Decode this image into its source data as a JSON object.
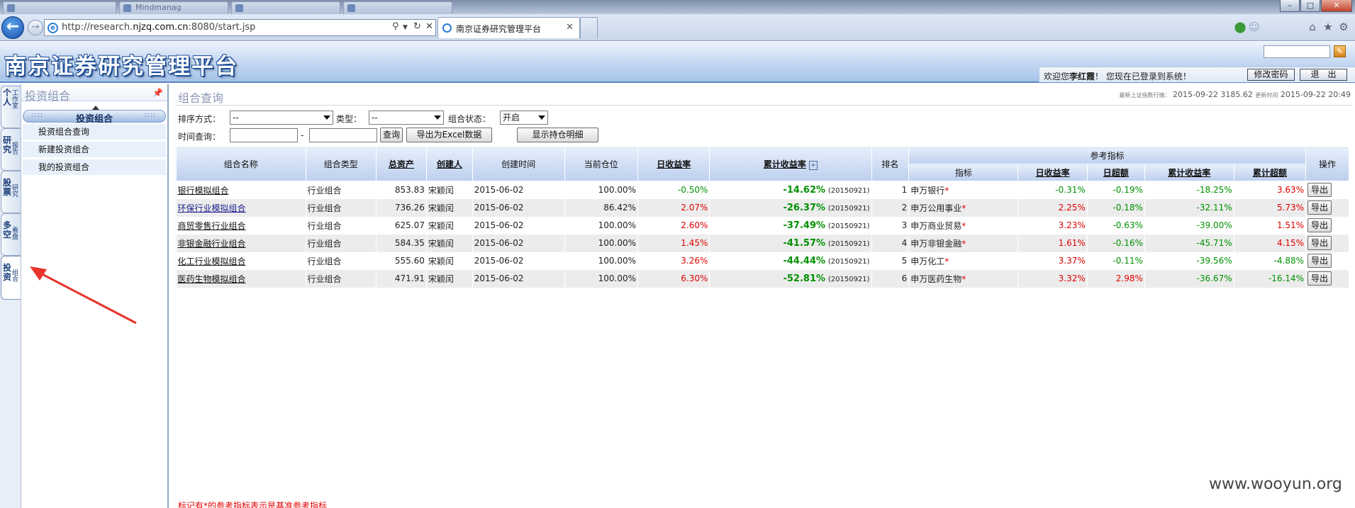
{
  "browser": {
    "background_tabs": [
      "",
      "Mindmanag",
      "",
      ""
    ],
    "address": "http://research.njzq.com.cn:8080/start.jsp",
    "address_prefix": "http://research.",
    "address_domain": "njzq.com.cn",
    "address_suffix": ":8080/start.jsp",
    "active_tab_title": "南京证券研究管理平台",
    "back_icon": "back-arrow-icon",
    "forward_icon": "forward-arrow-icon"
  },
  "header": {
    "app_title": "南京证券研究管理平台",
    "welcome_prefix": "欢迎您",
    "user_name": "李红霞",
    "welcome_suffix": "！ 您现在已登录到系统！",
    "change_password": "修改密码",
    "logout": "退　出"
  },
  "vtabs": [
    {
      "big": "个人",
      "small": "工作室"
    },
    {
      "big": "研究",
      "small": "报告"
    },
    {
      "big": "股票",
      "small": "研究"
    },
    {
      "big": "多空",
      "small": "看盘"
    },
    {
      "big": "投资",
      "small": "组合"
    }
  ],
  "left_panel": {
    "title": "投资组合",
    "section": "投资组合",
    "items": [
      "投资组合查询",
      "新建投资组合",
      "我的投资组合"
    ]
  },
  "main": {
    "title": "组合查询",
    "update_label": "最新上证指数行情：",
    "update_value": "2015-09-22 3185.62",
    "update_time_label": "更新时间",
    "update_time": "2015-09-22 20:49",
    "filters": {
      "sort_label": "排序方式：",
      "sort_value": "--",
      "type_label": "类型：",
      "type_value": "--",
      "status_label": "组合状态：",
      "status_value": "开启",
      "time_label": "时间查询：",
      "time_sep": "-",
      "query_btn": "查询",
      "export_excel_btn": "导出为Excel数据",
      "show_holdings_btn": "显示持仓明细"
    },
    "table": {
      "headers": {
        "name": "组合名称",
        "type": "组合类型",
        "assets": "总资产",
        "creator": "创建人",
        "created": "创建时间",
        "position": "当前仓位",
        "daily": "日收益率",
        "cumulative": "累计收益率",
        "rank": "排名",
        "ref_group": "参考指标",
        "ref_index": "指标",
        "ref_daily": "日收益率",
        "ref_daily_excess": "日超额",
        "ref_cum": "累计收益率",
        "ref_cum_excess": "累计超额",
        "action": "操作"
      },
      "rows": [
        {
          "name": "银行模拟组合",
          "type": "行业组合",
          "assets": "853.83",
          "creator": "宋颖闰",
          "created": "2015-06-02",
          "position": "100.00%",
          "daily": "-0.50%",
          "daily_color": "green",
          "cum": "-14.62%",
          "cum_date": "(20150921)",
          "rank": "1",
          "index": "申万银行",
          "ref_daily": "-0.31%",
          "ref_daily_color": "green",
          "ref_excess": "-0.19%",
          "ref_excess_color": "green",
          "ref_cum": "-18.25%",
          "ref_cum_excess": "3.63%",
          "ref_cum_excess_color": "red",
          "action": "导出"
        },
        {
          "name": "环保行业模拟组合",
          "type": "行业组合",
          "assets": "736.26",
          "creator": "宋颖闰",
          "created": "2015-06-02",
          "position": "86.42%",
          "daily": "2.07%",
          "daily_color": "red",
          "cum": "-26.37%",
          "cum_date": "(20150921)",
          "rank": "2",
          "index": "申万公用事业",
          "ref_daily": "2.25%",
          "ref_daily_color": "red",
          "ref_excess": "-0.18%",
          "ref_excess_color": "green",
          "ref_cum": "-32.11%",
          "ref_cum_excess": "5.73%",
          "ref_cum_excess_color": "red",
          "action": "导出"
        },
        {
          "name": "商贸零售行业组合",
          "type": "行业组合",
          "assets": "625.07",
          "creator": "宋颖闰",
          "created": "2015-06-02",
          "position": "100.00%",
          "daily": "2.60%",
          "daily_color": "red",
          "cum": "-37.49%",
          "cum_date": "(20150921)",
          "rank": "3",
          "index": "申万商业贸易",
          "ref_daily": "3.23%",
          "ref_daily_color": "red",
          "ref_excess": "-0.63%",
          "ref_excess_color": "green",
          "ref_cum": "-39.00%",
          "ref_cum_excess": "1.51%",
          "ref_cum_excess_color": "red",
          "action": "导出"
        },
        {
          "name": "非银金融行业组合",
          "type": "行业组合",
          "assets": "584.35",
          "creator": "宋颖闰",
          "created": "2015-06-02",
          "position": "100.00%",
          "daily": "1.45%",
          "daily_color": "red",
          "cum": "-41.57%",
          "cum_date": "(20150921)",
          "rank": "4",
          "index": "申万非银金融",
          "ref_daily": "1.61%",
          "ref_daily_color": "red",
          "ref_excess": "-0.16%",
          "ref_excess_color": "green",
          "ref_cum": "-45.71%",
          "ref_cum_excess": "4.15%",
          "ref_cum_excess_color": "red",
          "action": "导出"
        },
        {
          "name": "化工行业模拟组合",
          "type": "行业组合",
          "assets": "555.60",
          "creator": "宋颖闰",
          "created": "2015-06-02",
          "position": "100.00%",
          "daily": "3.26%",
          "daily_color": "red",
          "cum": "-44.44%",
          "cum_date": "(20150921)",
          "rank": "5",
          "index": "申万化工",
          "ref_daily": "3.37%",
          "ref_daily_color": "red",
          "ref_excess": "-0.11%",
          "ref_excess_color": "green",
          "ref_cum": "-39.56%",
          "ref_cum_excess": "-4.88%",
          "ref_cum_excess_color": "green",
          "action": "导出"
        },
        {
          "name": "医药生物模拟组合",
          "type": "行业组合",
          "assets": "471.91",
          "creator": "宋颖闰",
          "created": "2015-06-02",
          "position": "100.00%",
          "daily": "6.30%",
          "daily_color": "red",
          "cum": "-52.81%",
          "cum_date": "(20150921)",
          "rank": "6",
          "index": "申万医药生物",
          "ref_daily": "3.32%",
          "ref_daily_color": "red",
          "ref_excess": "2.98%",
          "ref_excess_color": "red",
          "ref_cum": "-36.67%",
          "ref_cum_excess": "-16.14%",
          "ref_cum_excess_color": "green",
          "action": "导出"
        }
      ]
    },
    "footnote": "标记有*的参考指标表示是基准参考指标"
  },
  "watermark": "www.wooyun.org",
  "colors": {
    "accent": "#5d86c3",
    "positive": "#e00000",
    "negative": "#009000",
    "annotation_arrow": "#e8342c"
  }
}
